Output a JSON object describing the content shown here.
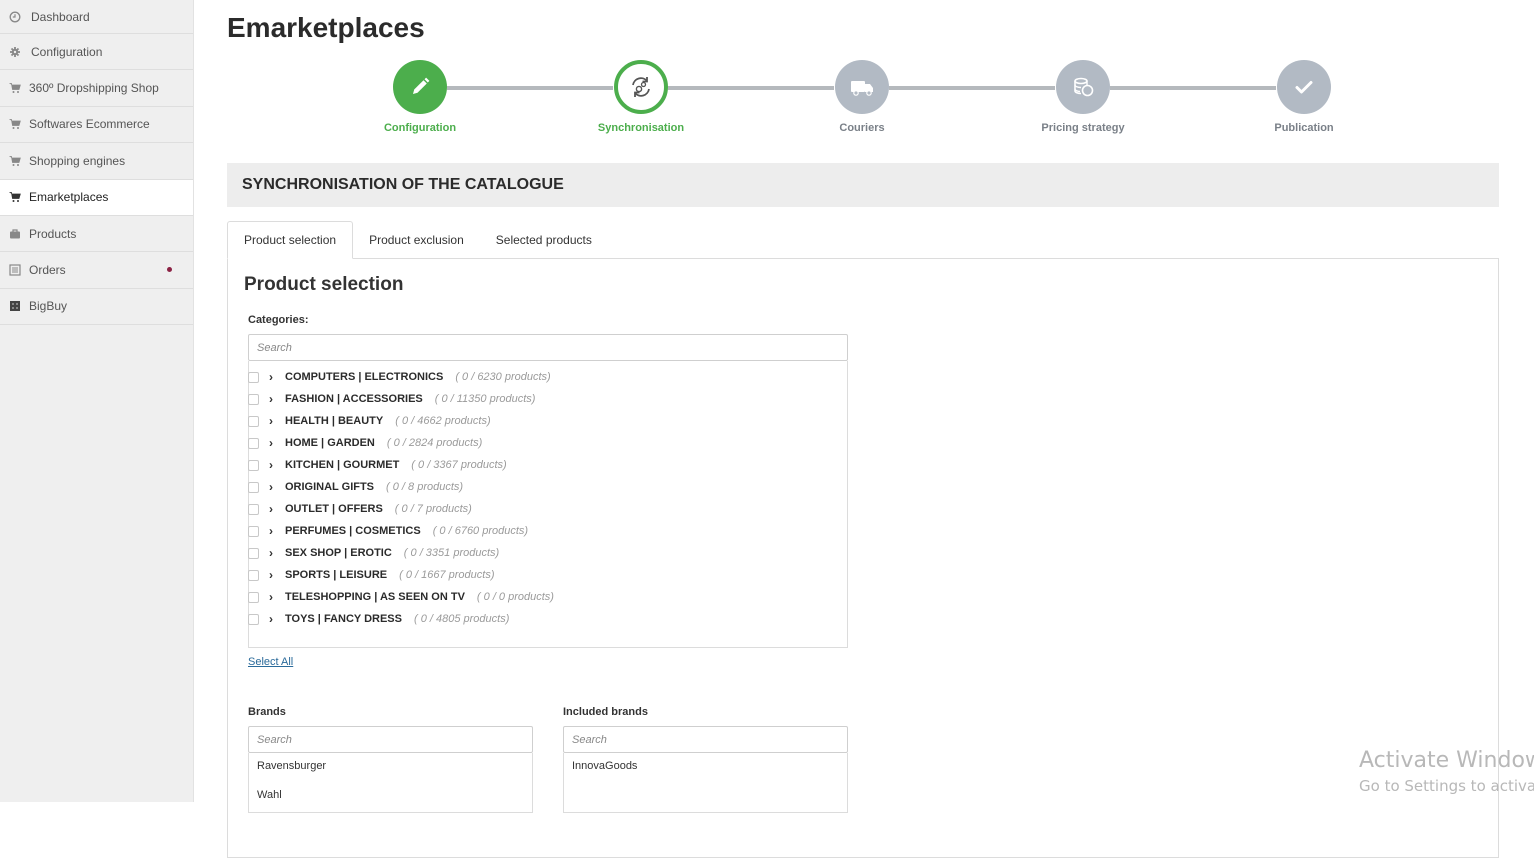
{
  "sidebar": {
    "items": [
      {
        "label": "Dashboard",
        "icon": "clock-icon"
      },
      {
        "label": "Configuration",
        "icon": "gear-icon"
      },
      {
        "label": "360º Dropshipping Shop",
        "icon": "cart-icon"
      },
      {
        "label": "Softwares Ecommerce",
        "icon": "cart-icon"
      },
      {
        "label": "Shopping engines",
        "icon": "cart-icon"
      },
      {
        "label": "Emarketplaces",
        "icon": "cart-icon",
        "active": true
      },
      {
        "label": "Products",
        "icon": "briefcase-icon"
      },
      {
        "label": "Orders",
        "icon": "list-icon",
        "notification": true
      },
      {
        "label": "BigBuy",
        "icon": "bigbuy-logo-icon"
      }
    ]
  },
  "page": {
    "title": "Emarketplaces"
  },
  "stepper": {
    "steps": [
      {
        "label": "Configuration",
        "state": "done",
        "icon": "pencil-icon"
      },
      {
        "label": "Synchronisation",
        "state": "current",
        "icon": "sync-gears-icon"
      },
      {
        "label": "Couriers",
        "state": "pending",
        "icon": "truck-icon"
      },
      {
        "label": "Pricing strategy",
        "state": "pending",
        "icon": "coins-icon"
      },
      {
        "label": "Publication",
        "state": "pending",
        "icon": "check-icon"
      }
    ],
    "colors": {
      "active": "#4cae4c",
      "pending": "#b2bac4"
    }
  },
  "section": {
    "title": "SYNCHRONISATION OF THE CATALOGUE"
  },
  "tabs": [
    {
      "label": "Product selection",
      "active": true
    },
    {
      "label": "Product exclusion"
    },
    {
      "label": "Selected products"
    }
  ],
  "panel": {
    "title": "Product selection",
    "categories_label": "Categories:",
    "search_placeholder": "Search",
    "categories": [
      {
        "name": "COMPUTERS | ELECTRONICS",
        "count": "( 0 / 6230 products)"
      },
      {
        "name": "FASHION | ACCESSORIES",
        "count": "( 0 / 11350 products)"
      },
      {
        "name": "HEALTH | BEAUTY",
        "count": "( 0 / 4662 products)"
      },
      {
        "name": "HOME | GARDEN",
        "count": "( 0 / 2824 products)"
      },
      {
        "name": "KITCHEN | GOURMET",
        "count": "( 0 / 3367 products)"
      },
      {
        "name": "ORIGINAL GIFTS",
        "count": "( 0 / 8 products)"
      },
      {
        "name": "OUTLET | OFFERS",
        "count": "( 0 / 7 products)"
      },
      {
        "name": "PERFUMES | COSMETICS",
        "count": "( 0 / 6760 products)"
      },
      {
        "name": "SEX SHOP | EROTIC",
        "count": "( 0 / 3351 products)"
      },
      {
        "name": "SPORTS | LEISURE",
        "count": "( 0 / 1667 products)"
      },
      {
        "name": "TELESHOPPING | AS SEEN ON TV",
        "count": "( 0 / 0 products)"
      },
      {
        "name": "TOYS | FANCY DRESS",
        "count": "( 0 / 4805 products)"
      }
    ],
    "select_all": "Select All",
    "brands": {
      "label": "Brands",
      "search_placeholder": "Search",
      "items": [
        "Ravensburger",
        "Wahl"
      ]
    },
    "included_brands": {
      "label": "Included brands",
      "search_placeholder": "Search",
      "items": [
        "InnovaGoods"
      ]
    }
  },
  "watermark": {
    "line1": "Activate Windows",
    "line2": "Go to Settings to activate Windows."
  }
}
